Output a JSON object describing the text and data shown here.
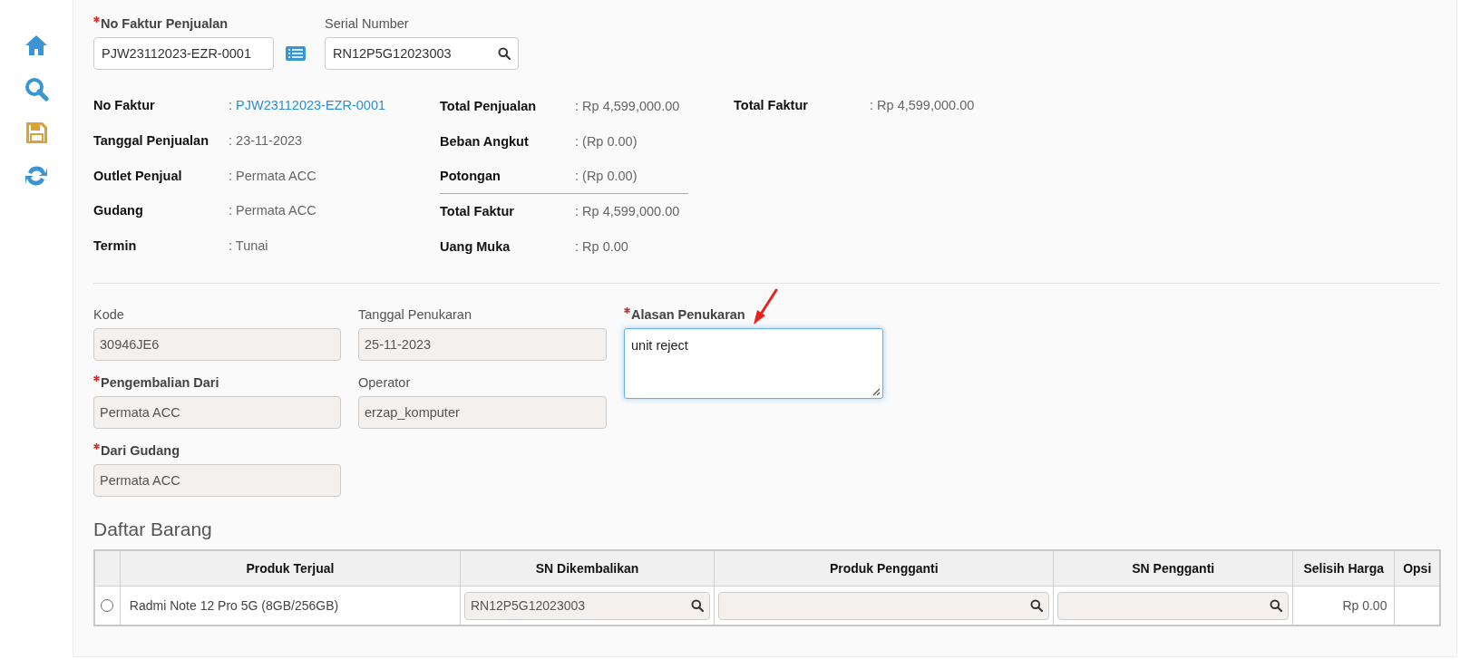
{
  "sidebar": {
    "items": [
      {
        "kind": "home"
      },
      {
        "kind": "search"
      },
      {
        "kind": "save"
      },
      {
        "kind": "refresh"
      }
    ]
  },
  "invoice_search": {
    "label": "No Faktur Penjualan",
    "required": true,
    "value": "PJW23112023-EZR-0001"
  },
  "serial_search": {
    "label": "Serial Number",
    "required": false,
    "value": "RN12P5G12023003"
  },
  "invoice_info": {
    "columns": [
      [
        {
          "label": "No Faktur",
          "colon": ":",
          "value": "PJW23112023-EZR-0001",
          "kind": "link"
        },
        {
          "label": "Tanggal Penjualan",
          "colon": ":",
          "value": "23-11-2023",
          "kind": "text"
        },
        {
          "label": "Outlet Penjual",
          "colon": ":",
          "value": "Permata ACC",
          "kind": "text"
        },
        {
          "label": "Gudang",
          "colon": ":",
          "value": "Permata ACC",
          "kind": "text"
        },
        {
          "label": "Termin",
          "colon": ":",
          "value": "Tunai",
          "kind": "text"
        }
      ],
      [
        {
          "label": "Total Penjualan",
          "colon": ":",
          "value": "Rp 4,599,000.00",
          "kind": "text",
          "rule_above": false
        },
        {
          "label": "Beban Angkut",
          "colon": ":",
          "value": "(Rp 0.00)",
          "kind": "text",
          "rule_above": false
        },
        {
          "label": "Potongan",
          "colon": ":",
          "value": "(Rp 0.00)",
          "kind": "text",
          "rule_above": false
        },
        {
          "label": "Total Faktur",
          "colon": ":",
          "value": "Rp 4,599,000.00",
          "kind": "text",
          "rule_above": true
        },
        {
          "label": "Uang Muka",
          "colon": ":",
          "value": "Rp 0.00",
          "kind": "text",
          "rule_above": false
        }
      ],
      [
        {
          "label": "Total Faktur",
          "colon": ":",
          "value": "Rp 4,599,000.00",
          "kind": "text"
        }
      ]
    ]
  },
  "exchange_form": {
    "columns": [
      [
        {
          "label": "Kode",
          "required": false,
          "value": "30946JE6",
          "kind": "readonly"
        },
        {
          "label": "Pengembalian Dari",
          "required": true,
          "value": "Permata ACC",
          "kind": "readonly"
        },
        {
          "label": "Dari Gudang",
          "required": true,
          "value": "Permata ACC",
          "kind": "readonly"
        }
      ],
      [
        {
          "label": "Tanggal Penukaran",
          "required": false,
          "value": "25-11-2023",
          "kind": "readonly"
        },
        {
          "label": "Operator",
          "required": false,
          "value": "erzap_komputer",
          "kind": "readonly"
        }
      ],
      [
        {
          "label": "Alasan Penukaran",
          "required": true,
          "value": "unit reject",
          "kind": "textarea"
        }
      ]
    ]
  },
  "items_table": {
    "title": "Daftar Barang",
    "columns": [
      "Produk Terjual",
      "SN Dikembalikan",
      "Produk Pengganti",
      "SN Pengganti",
      "Selisih Harga",
      "Opsi"
    ],
    "rows": [
      {
        "selected": false,
        "product": "Radmi Note 12 Pro 5G (8GB/256GB)",
        "sn_returned": "RN12P5G12023003",
        "price_difference": "Rp 0.00"
      }
    ]
  }
}
